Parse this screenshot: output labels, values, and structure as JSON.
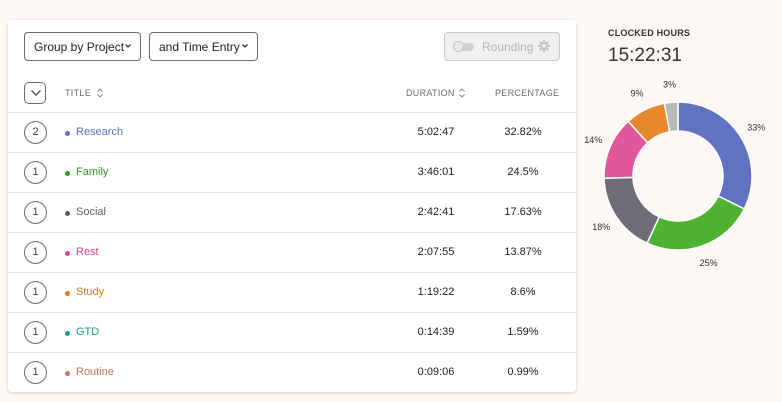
{
  "toolbar": {
    "group_by": "Group by Project",
    "secondary": "and Time Entry",
    "rounding_label": "Rounding"
  },
  "table": {
    "headers": {
      "title": "TITLE",
      "duration": "DURATION",
      "percentage": "PERCENTAGE"
    },
    "rows": [
      {
        "count": "2",
        "name": "Research",
        "duration": "5:02:47",
        "percentage": "32.82%",
        "color": "#5c70c2"
      },
      {
        "count": "1",
        "name": "Family",
        "duration": "3:46:01",
        "percentage": "24.5%",
        "color": "#2e9a1e"
      },
      {
        "count": "1",
        "name": "Social",
        "duration": "2:42:41",
        "percentage": "17.63%",
        "color": "#5c5c70"
      },
      {
        "count": "1",
        "name": "Rest",
        "duration": "2:07:55",
        "percentage": "13.87%",
        "color": "#d6478c"
      },
      {
        "count": "1",
        "name": "Study",
        "duration": "1:19:22",
        "percentage": "8.6%",
        "color": "#d97b10"
      },
      {
        "count": "1",
        "name": "GTD",
        "duration": "0:14:39",
        "percentage": "1.59%",
        "color": "#139e8c"
      },
      {
        "count": "1",
        "name": "Routine",
        "duration": "0:09:06",
        "percentage": "0.99%",
        "color": "#c07a58"
      }
    ]
  },
  "summary": {
    "label": "CLOCKED HOURS",
    "value": "15:22:31"
  },
  "chart_data": {
    "type": "pie",
    "categories": [
      "Research",
      "Family",
      "Social",
      "Rest",
      "Study",
      "GTD + Routine"
    ],
    "values": [
      33,
      25,
      18,
      14,
      9,
      3
    ],
    "labels": [
      "33%",
      "25%",
      "18%",
      "14%",
      "9%",
      "3%"
    ],
    "colors": [
      "#6272c2",
      "#4db22f",
      "#6e6d78",
      "#e0579a",
      "#e8882c",
      "#b8b8b8"
    ]
  }
}
